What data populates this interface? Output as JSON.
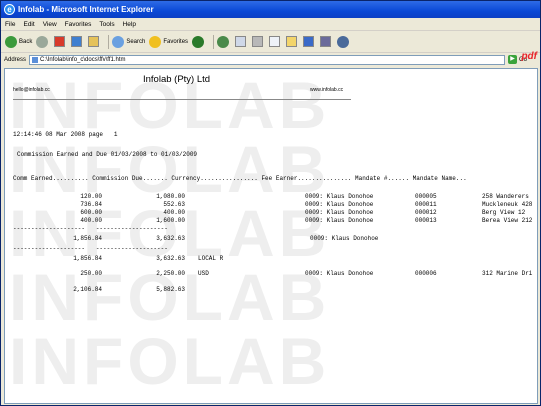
{
  "window": {
    "title": "Infolab - Microsoft Internet Explorer"
  },
  "menu": [
    "File",
    "Edit",
    "View",
    "Favorites",
    "Tools",
    "Help"
  ],
  "toolbar": {
    "back": "Back",
    "search": "Search",
    "favorites": "Favorites"
  },
  "address": {
    "label": "Address",
    "value": "C:\\Infolab\\info_c\\docs\\ffv\\ff1.htm",
    "go": "Go"
  },
  "pdf": "pdf",
  "watermark": "INFOLAB",
  "report": {
    "company": "Infolab (Pty) Ltd",
    "email": "hello@infolab.cc",
    "website": "www.infolab.cc",
    "timestamp": "12:14:46 08 Mar 2008 page   1",
    "heading": "Commission Earned and Due 01/03/2008 to 01/03/2009",
    "columns": "Comm Earned.......... Commission Due....... Currency................ Fee Earner............... Mandate #...... Mandate Name...",
    "rows": [
      {
        "earned": "120.00",
        "due": "1,080.00",
        "currency": "",
        "fee_earner": "0009: Klaus Donohoe",
        "mandate": "000005",
        "name": "258 Wanderers"
      },
      {
        "earned": "736.84",
        "due": "552.63",
        "currency": "",
        "fee_earner": "0009: Klaus Donohoe",
        "mandate": "000011",
        "name": "Muckleneuk 428"
      },
      {
        "earned": "600.00",
        "due": "400.00",
        "currency": "",
        "fee_earner": "0009: Klaus Donohoe",
        "mandate": "000012",
        "name": "Berg View 12"
      },
      {
        "earned": "400.00",
        "due": "1,600.00",
        "currency": "",
        "fee_earner": "0009: Klaus Donohoe",
        "mandate": "000013",
        "name": "Berea View 212"
      }
    ],
    "dashes": "--------------------   --------------------",
    "subtotal": {
      "earned": "1,856.84",
      "due": "3,632.63",
      "fee_earner": "0009: Klaus Donohoe"
    },
    "local_total": {
      "earned": "1,856.84",
      "due": "3,632.63",
      "label": "LOCAL R"
    },
    "usd_row": {
      "earned": "250.00",
      "due": "2,250.00",
      "currency": "USD",
      "fee_earner": "0009: Klaus Donohoe",
      "mandate": "000006",
      "name": "312 Marine Dri"
    },
    "grand_total": {
      "earned": "2,106.84",
      "due": "5,882.63"
    }
  }
}
